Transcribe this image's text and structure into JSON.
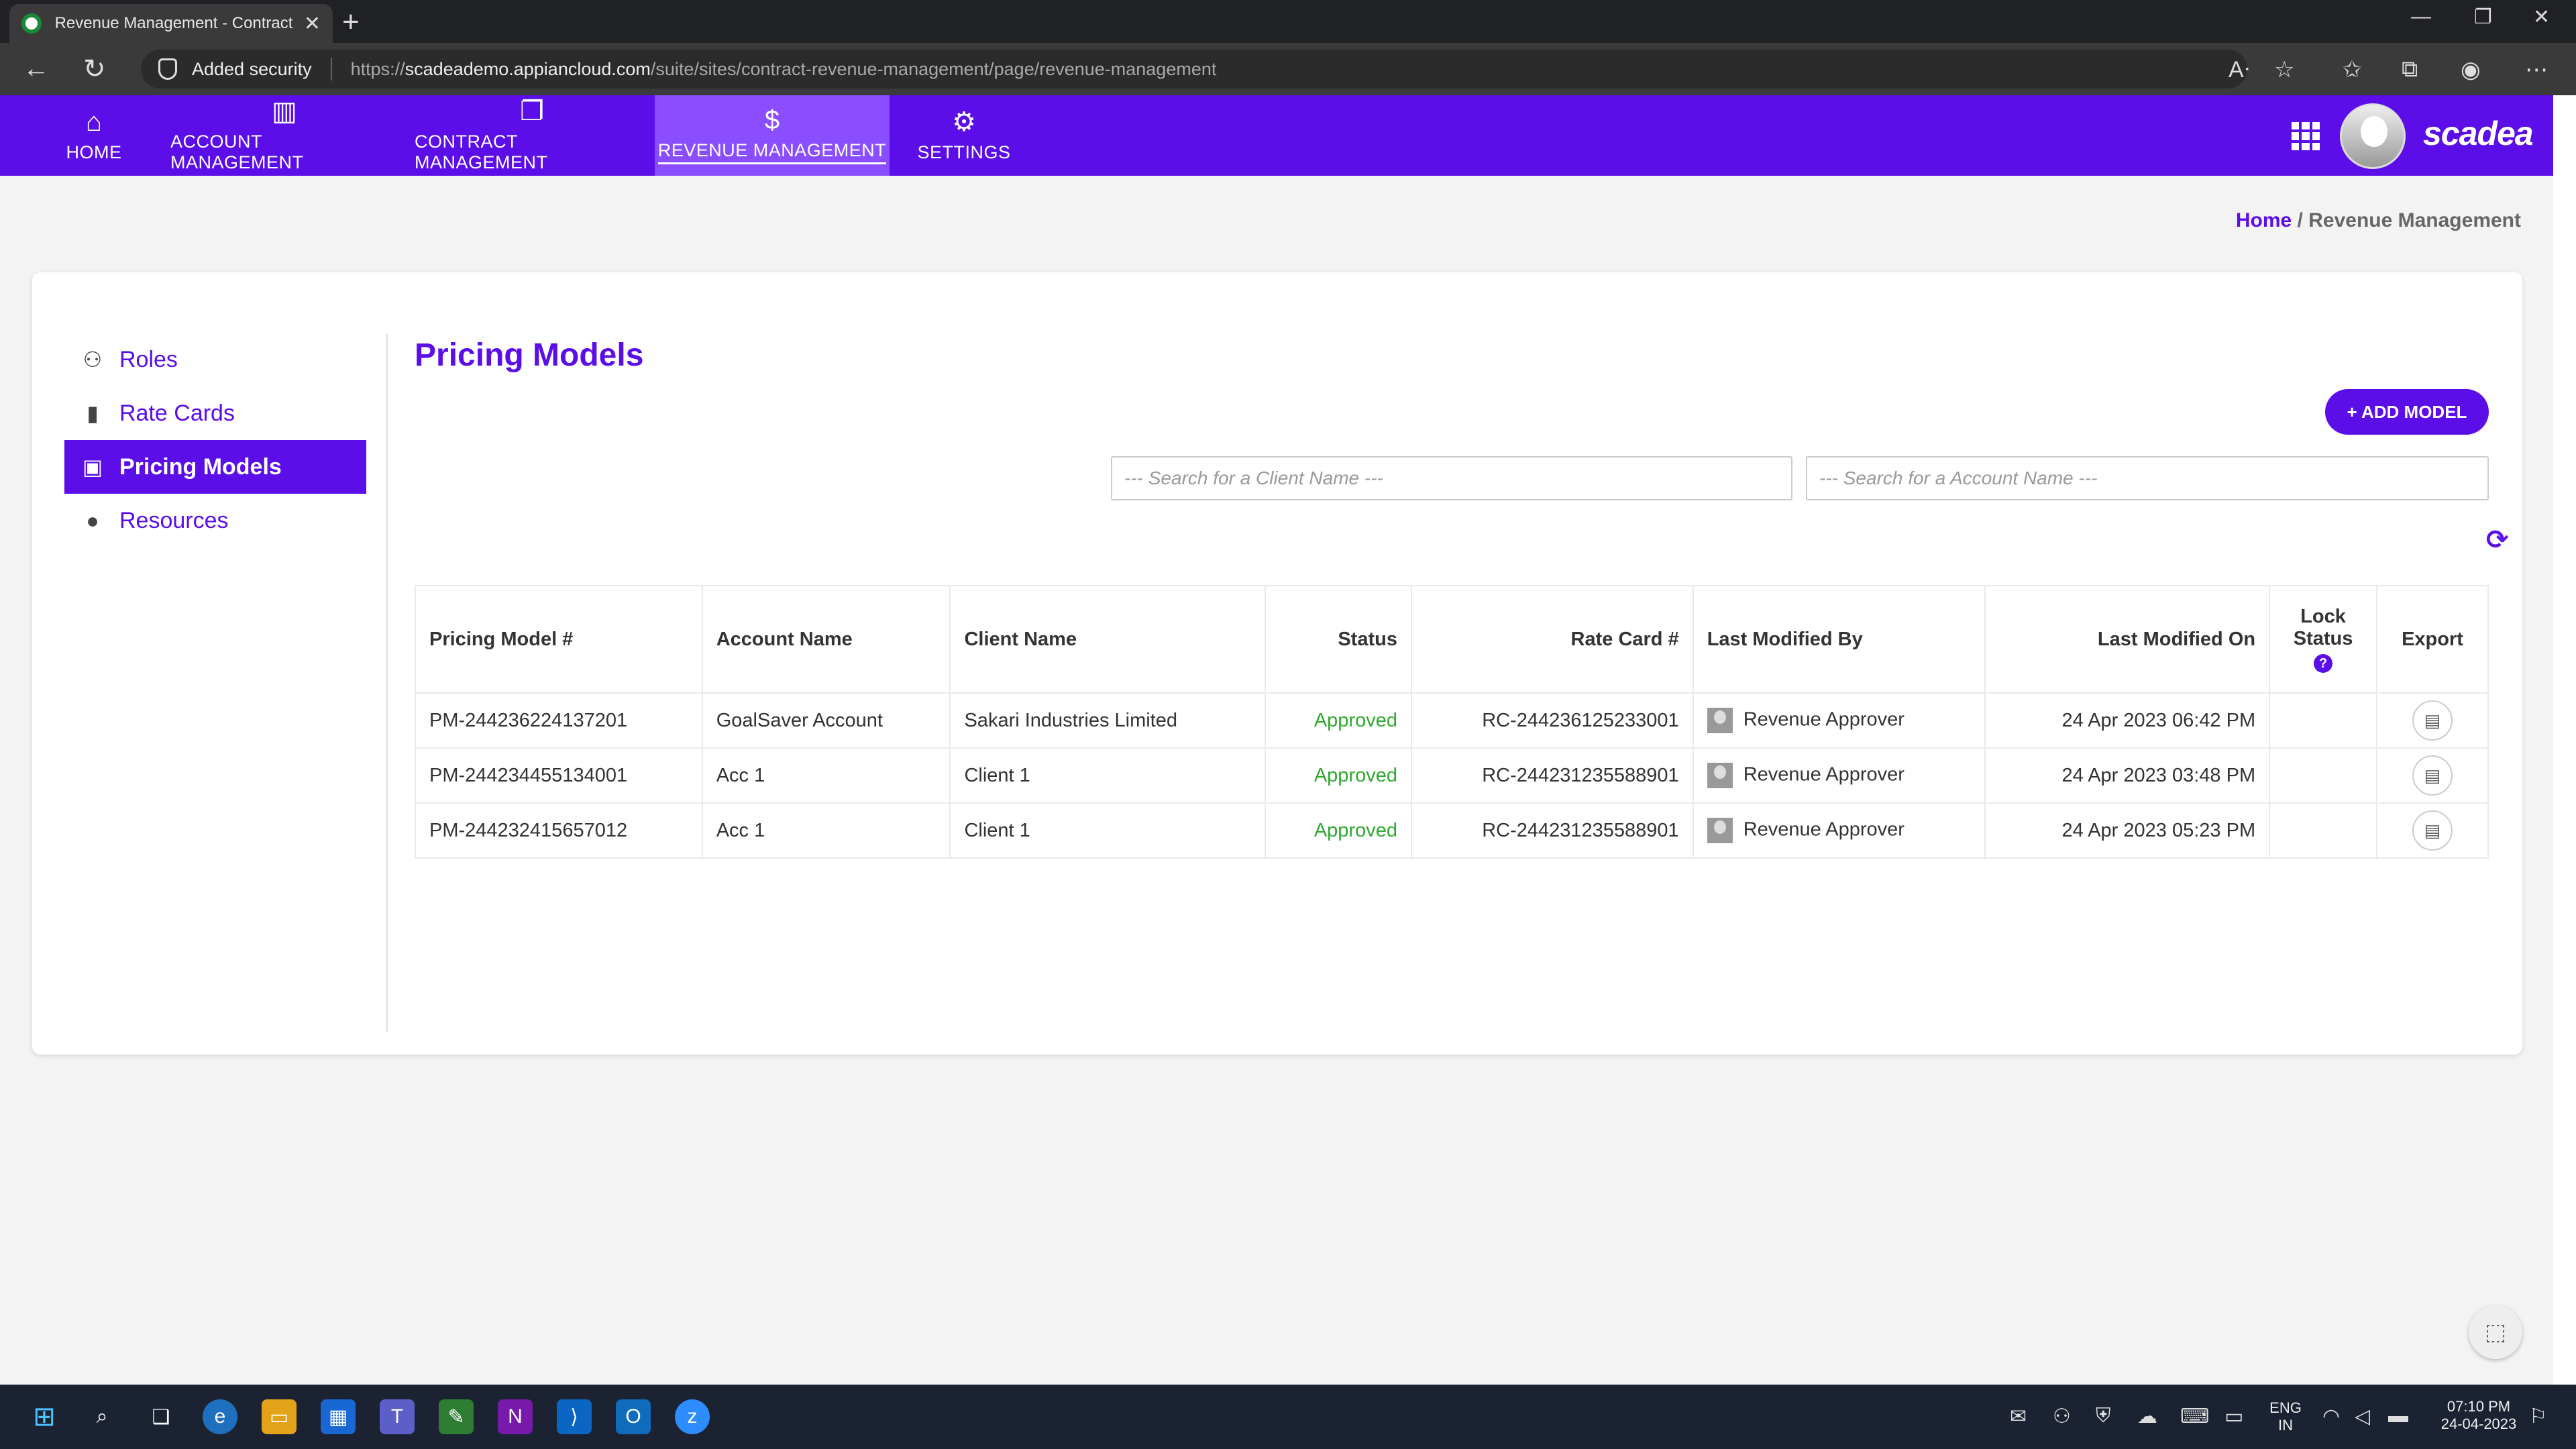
{
  "browser": {
    "tab_title": "Revenue Management - Contract Revenue Management",
    "security_label": "Added security",
    "url_prefix": "https://",
    "url_host": "scadeademo.appiancloud.com",
    "url_path": "/suite/sites/contract-revenue-management/page/revenue-management"
  },
  "header": {
    "nav": [
      {
        "label": "HOME",
        "icon": "home-icon"
      },
      {
        "label": "ACCOUNT MANAGEMENT",
        "icon": "building-icon"
      },
      {
        "label": "CONTRACT MANAGEMENT",
        "icon": "documents-icon"
      },
      {
        "label": "REVENUE MANAGEMENT",
        "icon": "dollar-icon",
        "active": true
      },
      {
        "label": "SETTINGS",
        "icon": "gear-icon"
      }
    ],
    "logo_text": "scadea",
    "accent_color": "#5b0ee8"
  },
  "breadcrumb": {
    "home": "Home",
    "separator": "/",
    "current": "Revenue Management"
  },
  "sidebar": {
    "items": [
      {
        "label": "Roles",
        "icon": "roles-icon"
      },
      {
        "label": "Rate Cards",
        "icon": "document-icon"
      },
      {
        "label": "Pricing Models",
        "icon": "money-icon",
        "active": true
      },
      {
        "label": "Resources",
        "icon": "person-icon"
      }
    ]
  },
  "main": {
    "title": "Pricing Models",
    "add_button_label": "+ ADD MODEL",
    "search_client_placeholder": "--- Search for a Client Name ---",
    "search_account_placeholder": "--- Search for a Account Name ---",
    "table": {
      "headers": {
        "pricing_model": "Pricing Model #",
        "account_name": "Account Name",
        "client_name": "Client Name",
        "status": "Status",
        "rate_card": "Rate Card #",
        "last_modified_by": "Last Modified By",
        "last_modified_on": "Last Modified On",
        "lock_status_1": "Lock",
        "lock_status_2": "Status",
        "export": "Export"
      },
      "rows": [
        {
          "pricing_model": "PM-244236224137201",
          "account_name": "GoalSaver Account",
          "client_name": "Sakari Industries Limited",
          "status": "Approved",
          "rate_card": "RC-244236125233001",
          "last_modified_by": "Revenue Approver",
          "last_modified_on": "24 Apr 2023 06:42 PM"
        },
        {
          "pricing_model": "PM-244234455134001",
          "account_name": "Acc 1",
          "client_name": "Client 1",
          "status": "Approved",
          "rate_card": "RC-244231235588901",
          "last_modified_by": "Revenue Approver",
          "last_modified_on": "24 Apr 2023 03:48 PM"
        },
        {
          "pricing_model": "PM-244232415657012",
          "account_name": "Acc 1",
          "client_name": "Client 1",
          "status": "Approved",
          "rate_card": "RC-244231235588901",
          "last_modified_by": "Revenue Approver",
          "last_modified_on": "24 Apr 2023 05:23 PM"
        }
      ],
      "status_color": "#2fa92f"
    }
  },
  "taskbar": {
    "lang_1": "ENG",
    "lang_2": "IN",
    "time": "07:10 PM",
    "date": "24-04-2023"
  }
}
